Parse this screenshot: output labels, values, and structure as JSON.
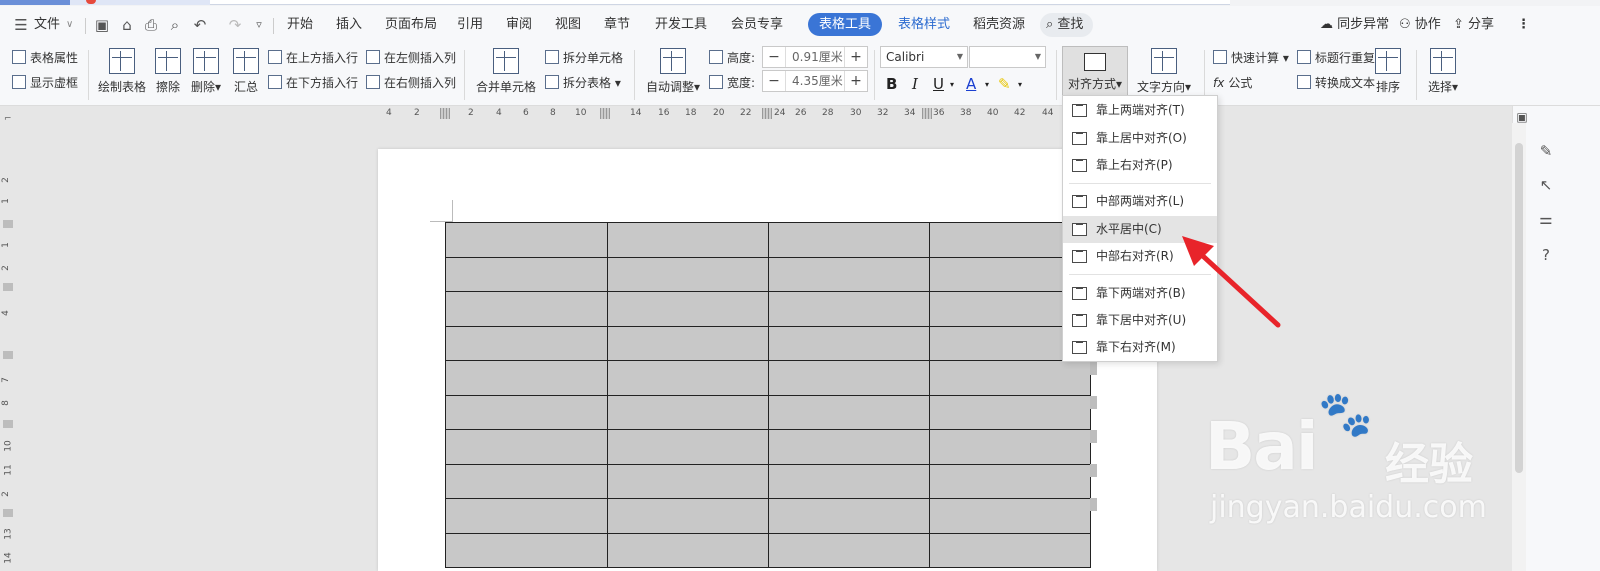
{
  "menubar": {
    "file": "文件",
    "tabs": [
      "开始",
      "插入",
      "页面布局",
      "引用",
      "审阅",
      "视图",
      "章节",
      "开发工具",
      "会员专享"
    ],
    "active_tab": "表格工具",
    "style_tab": "表格样式",
    "shell_tab": "稻壳资源",
    "search": "查找",
    "sync": "同步异常",
    "collab": "协作",
    "share": "分享"
  },
  "ribbon": {
    "table_props": "表格属性",
    "show_grid": "显示虚框",
    "draw_table": "绘制表格",
    "erase": "擦除",
    "delete": "删除",
    "summary": "汇总",
    "insert_above": "在上方插入行",
    "insert_below": "在下方插入行",
    "insert_left": "在左侧插入列",
    "insert_right": "在右侧插入列",
    "merge_cells": "合并单元格",
    "split_cells": "拆分单元格",
    "split_table": "拆分表格",
    "auto_adjust": "自动调整",
    "height_label": "高度:",
    "height_value": "0.91厘米",
    "width_label": "宽度:",
    "width_value": "4.35厘米",
    "font": "Calibri",
    "align": "对齐方式",
    "text_dir": "文字方向",
    "quick_calc": "快速计算",
    "formula": "公式",
    "repeat_header": "标题行重复",
    "to_text": "转换成文本",
    "sort": "排序",
    "select": "选择"
  },
  "ruler": [
    "4",
    "2",
    "2",
    "4",
    "6",
    "8",
    "10",
    "14",
    "16",
    "18",
    "20",
    "22",
    "24",
    "26",
    "28",
    "30",
    "32",
    "34",
    "36",
    "38",
    "40",
    "42",
    "44"
  ],
  "vruler": [
    "2",
    "1",
    "1",
    "2",
    "4",
    "7",
    "8",
    "10",
    "11",
    "2",
    "13",
    "14"
  ],
  "dropdown": {
    "items": [
      "靠上两端对齐(T)",
      "靠上居中对齐(O)",
      "靠上右对齐(P)",
      "中部两端对齐(L)",
      "水平居中(C)",
      "中部右对齐(R)",
      "靠下两端对齐(B)",
      "靠下居中对齐(U)",
      "靠下右对齐(M)"
    ],
    "selected": "水平居中(C)"
  },
  "watermark": {
    "brand": "Bai",
    "jingyan": "经验",
    "url": "jingyan.baidu.com"
  },
  "table": {
    "rows": 10,
    "cols": 4
  }
}
